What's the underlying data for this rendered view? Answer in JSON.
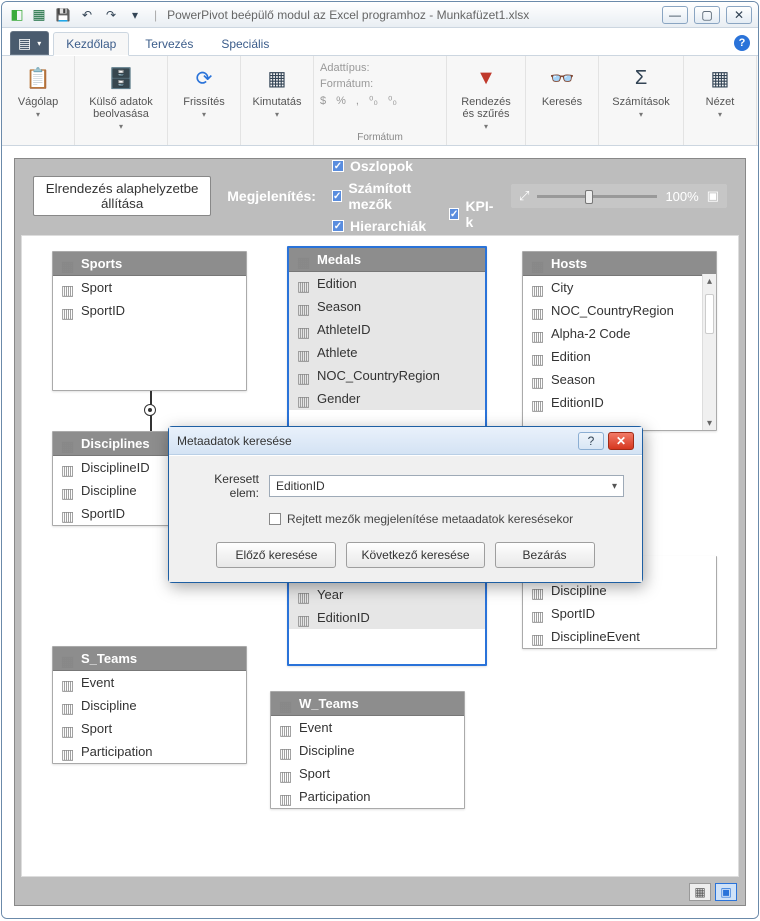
{
  "window": {
    "title": "PowerPivot beépülő modul az Excel programhoz - Munkafüzet1.xlsx"
  },
  "qat": {
    "save": "💾",
    "undo": "↶",
    "redo": "↷",
    "dropdown": "▾"
  },
  "tabs": {
    "file": "■",
    "home": "Kezdőlap",
    "design": "Tervezés",
    "advanced": "Speciális"
  },
  "ribbon": {
    "group_clipboard": {
      "btn1": "Vágólap"
    },
    "group_external": {
      "btn1": "Külső adatok beolvasása"
    },
    "group_refresh": {
      "btn1": "Frissítés"
    },
    "group_pivot": {
      "btn1": "Kimutatás"
    },
    "group_format": {
      "l1": "Adattípus:",
      "l2": "Formátum:",
      "sym1": "$",
      "sym2": "%",
      "sym3": ",",
      "sym4": "⁰₀",
      "sym5": "⁰₀",
      "label": "Formátum"
    },
    "group_sort": {
      "btn1": "Rendezés és szűrés"
    },
    "group_find": {
      "btn1": "Keresés"
    },
    "group_calc": {
      "btn1": "Számítások"
    },
    "group_view": {
      "btn1": "Nézet"
    }
  },
  "canvas": {
    "reset": "Elrendezés alaphelyzetbe állítása",
    "showlabel": "Megjelenítés:",
    "chk_cols": "Oszlopok",
    "chk_calc": "Számított mezők",
    "chk_hier": "Hierarchiák",
    "chk_kpi": "KPI-k",
    "zoom": "100%"
  },
  "tables": {
    "sports": {
      "title": "Sports",
      "rows": [
        "Sport",
        "SportID"
      ]
    },
    "medals": {
      "title": "Medals",
      "rows": [
        "Edition",
        "Season",
        "AthleteID",
        "Athlete",
        "NOC_CountryRegion",
        "Gender"
      ],
      "rows2": [
        "DisciplineEvent",
        "Year",
        "EditionID"
      ]
    },
    "hosts": {
      "title": "Hosts",
      "rows": [
        "City",
        "NOC_CountryRegion",
        "Alpha-2 Code",
        "Edition",
        "Season",
        "EditionID"
      ],
      "rows2": [
        "DisciplineID",
        "Discipline",
        "SportID",
        "DisciplineEvent"
      ]
    },
    "disciplines": {
      "title": "Disciplines",
      "rows": [
        "DisciplineID",
        "Discipline",
        "SportID"
      ]
    },
    "s_teams": {
      "title": "S_Teams",
      "rows": [
        "Event",
        "Discipline",
        "Sport",
        "Participation"
      ]
    },
    "w_teams": {
      "title": "W_Teams",
      "rows": [
        "Event",
        "Discipline",
        "Sport",
        "Participation"
      ]
    }
  },
  "dialog": {
    "title": "Metaadatok keresése",
    "find_label": "Keresett elem:",
    "find_value": "EditionID",
    "chk_hidden": "Rejtett mezők megjelenítése metaadatok keresésekor",
    "btn_prev": "Előző keresése",
    "btn_next": "Következő keresése",
    "btn_close": "Bezárás"
  }
}
